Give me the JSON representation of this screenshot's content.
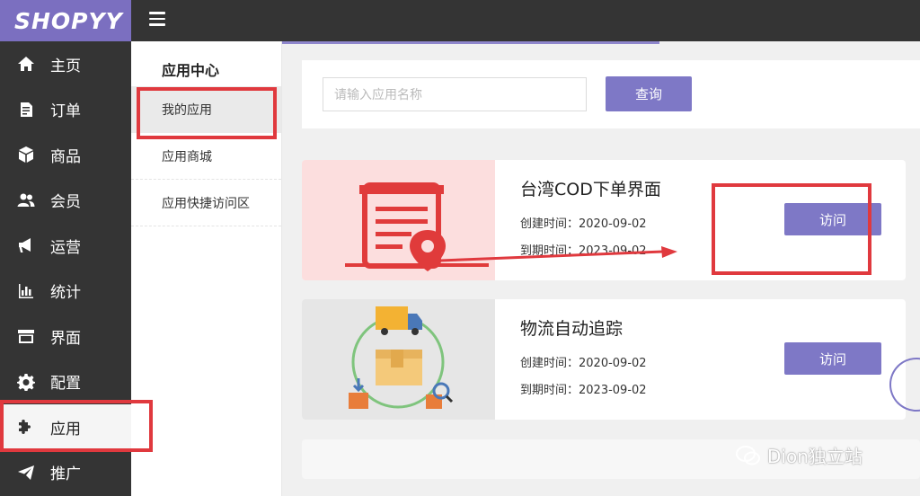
{
  "brand": {
    "logo": "SHOPYY"
  },
  "sidebar": {
    "items": [
      {
        "label": "主页",
        "icon": "home-icon"
      },
      {
        "label": "订单",
        "icon": "document-icon"
      },
      {
        "label": "商品",
        "icon": "box-icon"
      },
      {
        "label": "会员",
        "icon": "users-icon"
      },
      {
        "label": "运营",
        "icon": "megaphone-icon"
      },
      {
        "label": "统计",
        "icon": "bar-chart-icon"
      },
      {
        "label": "界面",
        "icon": "storefront-icon"
      },
      {
        "label": "配置",
        "icon": "gear-icon"
      },
      {
        "label": "应用",
        "icon": "puzzle-icon"
      },
      {
        "label": "推广",
        "icon": "paper-plane-icon"
      }
    ],
    "active_index": 8
  },
  "subnav": {
    "title": "应用中心",
    "items": [
      {
        "label": "我的应用"
      },
      {
        "label": "应用商城"
      },
      {
        "label": "应用快捷访问区"
      }
    ]
  },
  "search": {
    "placeholder": "请输入应用名称",
    "button": "查询"
  },
  "apps": [
    {
      "name": "台湾COD下单界面",
      "created": "创建时间：2020-09-02",
      "expires": "到期时间：2023-09-02",
      "button": "访问",
      "icon": "order-form-location-icon"
    },
    {
      "name": "物流自动追踪",
      "created": "创建时间：2020-09-02",
      "expires": "到期时间：2023-09-02",
      "button": "访问",
      "icon": "logistics-tracking-icon"
    }
  ],
  "watermark": {
    "text": "Dion独立站",
    "icon": "wechat-icon"
  },
  "colors": {
    "sidebar": "#343434",
    "accent": "#7e78c6",
    "logo_bg": "#7b6fc0",
    "highlight": "#e0393e"
  }
}
